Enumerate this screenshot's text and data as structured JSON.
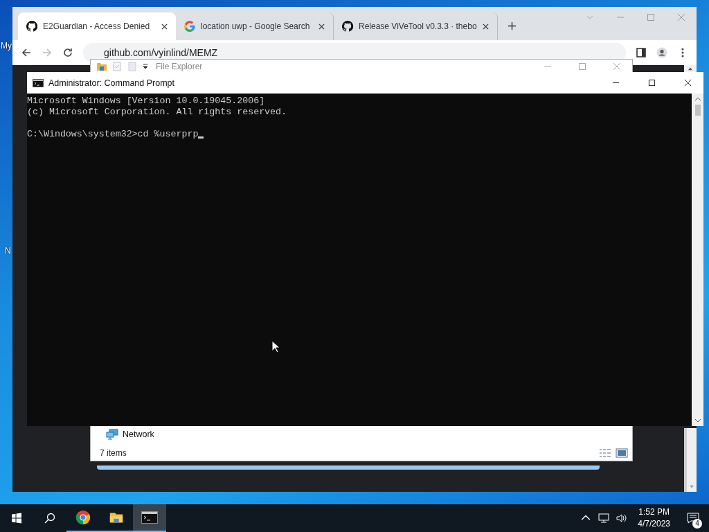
{
  "desktop": {
    "icon_labels": [
      "My",
      "N"
    ]
  },
  "browser": {
    "tabs": [
      {
        "title": "E2Guardian - Access Denied",
        "kind": "github",
        "selected": true
      },
      {
        "title": "location uwp - Google Search",
        "kind": "google",
        "selected": false
      },
      {
        "title": "Release ViVeTool v0.3.3 · thebo",
        "kind": "github",
        "selected": false
      }
    ],
    "address": "github.com/vyinlind/MEMZ"
  },
  "file_explorer": {
    "title": "File Explorer",
    "nav_item": "Network",
    "status": "7 items"
  },
  "cmd": {
    "title": "Administrator:  Command Prompt",
    "output": [
      "Microsoft Windows [Version 10.0.19045.2006]",
      "(c) Microsoft Corporation. All rights reserved."
    ],
    "prompt": "C:\\Windows\\system32>cd %userprp"
  },
  "taskbar": {
    "apps": [
      {
        "kind": "chrome",
        "selected": false
      },
      {
        "kind": "explorer",
        "selected": false
      },
      {
        "kind": "cmd",
        "selected": true
      }
    ],
    "time": "1:52 PM",
    "date": "4/7/2023",
    "notifications": "4"
  }
}
